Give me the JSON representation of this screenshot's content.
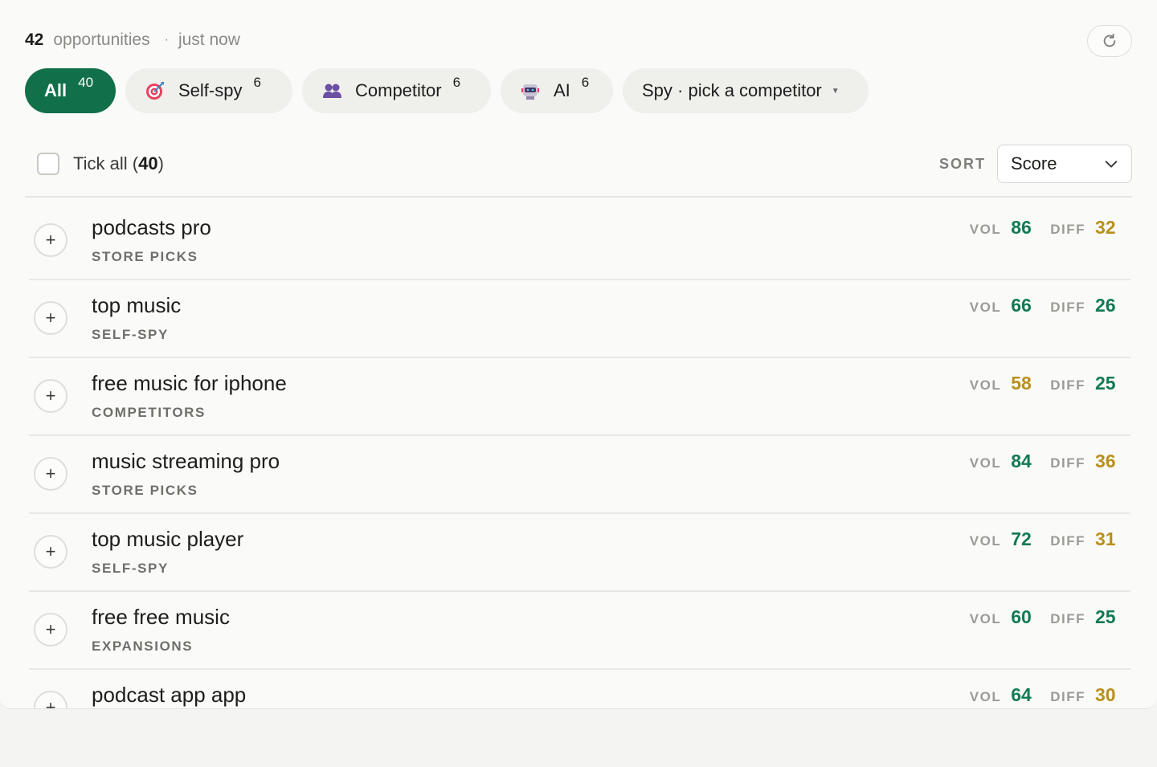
{
  "header": {
    "count": "42",
    "count_label": "opportunities",
    "separator": "·",
    "updated": "just now",
    "refresh_icon": "refresh-icon"
  },
  "filters": [
    {
      "label": "All",
      "count": "40",
      "active": true,
      "icon": ""
    },
    {
      "label": "Self-spy",
      "count": "6",
      "active": false,
      "icon": "target-icon"
    },
    {
      "label": "Competitor",
      "count": "6",
      "active": false,
      "icon": "people-icon"
    },
    {
      "label": "AI",
      "count": "6",
      "active": false,
      "icon": "robot-icon"
    },
    {
      "label": "Spy · pick a competitor",
      "count": "",
      "active": false,
      "icon": "caret-down-icon"
    }
  ],
  "toolbar": {
    "tick_all_label": "Tick all",
    "tick_all_count": "40",
    "sort_label": "SORT",
    "sort_value": "Score"
  },
  "colors": {
    "accent": "#11704a",
    "good": "#127a54",
    "warn": "#b8901c"
  },
  "labels": {
    "vol": "VOL",
    "diff": "DIFF",
    "add": "+"
  },
  "keywords": [
    {
      "keyword": "podcasts pro",
      "source": "STORE PICKS",
      "vol": "86",
      "vol_tone": "green",
      "diff": "32",
      "diff_tone": "amber"
    },
    {
      "keyword": "top music",
      "source": "SELF-SPY",
      "vol": "66",
      "vol_tone": "green",
      "diff": "26",
      "diff_tone": "green"
    },
    {
      "keyword": "free music for iphone",
      "source": "COMPETITORS",
      "vol": "58",
      "vol_tone": "amber",
      "diff": "25",
      "diff_tone": "green"
    },
    {
      "keyword": "music streaming pro",
      "source": "STORE PICKS",
      "vol": "84",
      "vol_tone": "green",
      "diff": "36",
      "diff_tone": "amber"
    },
    {
      "keyword": "top music player",
      "source": "SELF-SPY",
      "vol": "72",
      "vol_tone": "green",
      "diff": "31",
      "diff_tone": "amber"
    },
    {
      "keyword": "free free music",
      "source": "EXPANSIONS",
      "vol": "60",
      "vol_tone": "green",
      "diff": "25",
      "diff_tone": "green"
    },
    {
      "keyword": "podcast app app",
      "source": "",
      "vol": "64",
      "vol_tone": "green",
      "diff": "30",
      "diff_tone": "amber"
    }
  ]
}
